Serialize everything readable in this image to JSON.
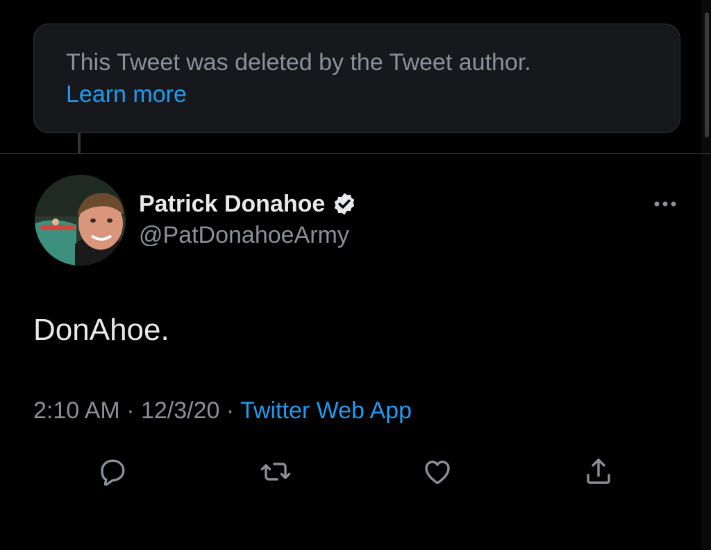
{
  "deleted_notice": {
    "text": "This Tweet was deleted by the Tweet author.",
    "link_label": "Learn more"
  },
  "author": {
    "name": "Patrick Donahoe",
    "handle": "@PatDonahoeArmy",
    "verified": true,
    "avatar_icon": "avatar-photo"
  },
  "tweet": {
    "text": "DonAhoe."
  },
  "meta": {
    "time": "2:10 AM",
    "separator_1": "·",
    "date": "12/3/20",
    "separator_2": "·",
    "source": "Twitter Web App"
  },
  "actions": [
    {
      "icon": "reply-icon"
    },
    {
      "icon": "retweet-icon"
    },
    {
      "icon": "like-icon"
    },
    {
      "icon": "share-icon"
    }
  ],
  "colors": {
    "background": "#000000",
    "card": "#16181c",
    "text_primary": "#e7e9ea",
    "text_secondary": "#8b9198",
    "accent": "#1d9bf0"
  }
}
